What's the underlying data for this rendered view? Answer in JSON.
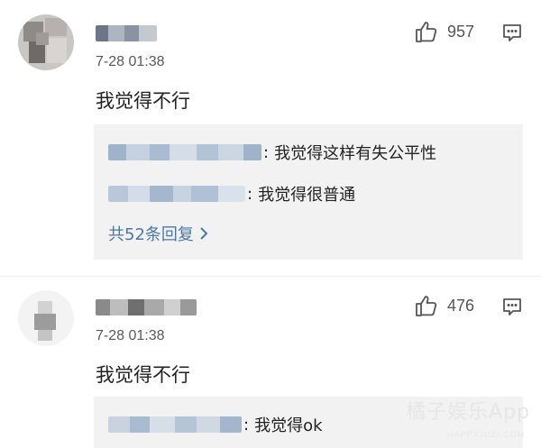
{
  "comments": [
    {
      "time": "7-28 01:38",
      "text": "我觉得不行",
      "likes": "957",
      "replies": [
        {
          "text": "我觉得这样有失公平性"
        },
        {
          "text": "我觉得很普通"
        }
      ],
      "more_replies": "共52条回复"
    },
    {
      "time": "7-28 01:38",
      "text": "我觉得不行",
      "likes": "476",
      "replies": [
        {
          "text": "我觉得ok"
        }
      ]
    }
  ],
  "icons": {
    "like": "thumbs-up-icon",
    "more": "comment-options-icon",
    "chevron": "chevron-right-icon"
  },
  "watermark": {
    "text": "橘子娱乐App",
    "sub": "HAPPYJUZI.COM"
  },
  "colors": {
    "link": "#4a78a8",
    "reply_bg": "#f2f2f2"
  }
}
